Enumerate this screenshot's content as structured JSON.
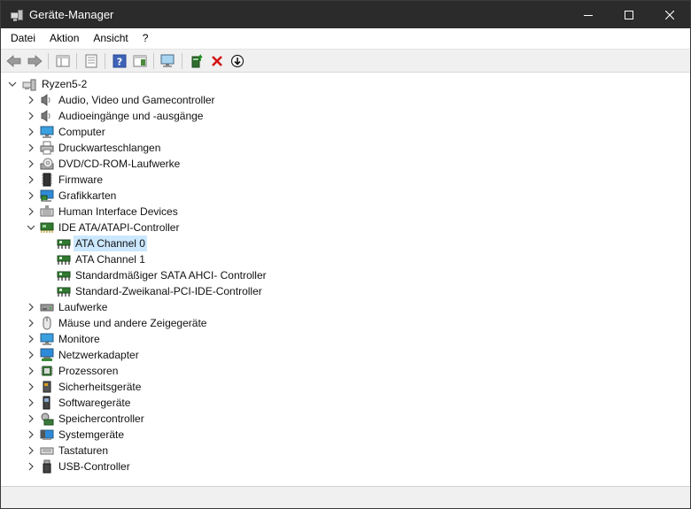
{
  "window": {
    "title": "Geräte-Manager"
  },
  "menu": [
    {
      "label": "Datei"
    },
    {
      "label": "Aktion"
    },
    {
      "label": "Ansicht"
    },
    {
      "label": "?"
    }
  ],
  "toolbar": {
    "icons": [
      "back-arrow-icon",
      "forward-arrow-icon",
      "show-hide-console-tree-icon",
      "properties-icon",
      "help-icon",
      "action-pane-icon",
      "scan-hardware-monitor-icon",
      "update-driver-icon",
      "uninstall-device-icon",
      "disable-device-icon"
    ]
  },
  "tree": {
    "root": "Ryzen5-2",
    "categories": [
      {
        "label": "Audio, Video und Gamecontroller",
        "expanded": false
      },
      {
        "label": "Audioeingänge und -ausgänge",
        "expanded": false
      },
      {
        "label": "Computer",
        "expanded": false
      },
      {
        "label": "Druckwarteschlangen",
        "expanded": false
      },
      {
        "label": "DVD/CD-ROM-Laufwerke",
        "expanded": false
      },
      {
        "label": "Firmware",
        "expanded": false
      },
      {
        "label": "Grafikkarten",
        "expanded": false
      },
      {
        "label": "Human Interface Devices",
        "expanded": false
      },
      {
        "label": "IDE ATA/ATAPI-Controller",
        "expanded": true
      },
      {
        "label": "Laufwerke",
        "expanded": false
      },
      {
        "label": "Mäuse und andere Zeigegeräte",
        "expanded": false
      },
      {
        "label": "Monitore",
        "expanded": false
      },
      {
        "label": "Netzwerkadapter",
        "expanded": false
      },
      {
        "label": "Prozessoren",
        "expanded": false
      },
      {
        "label": "Sicherheitsgeräte",
        "expanded": false
      },
      {
        "label": "Softwaregeräte",
        "expanded": false
      },
      {
        "label": "Speichercontroller",
        "expanded": false
      },
      {
        "label": "Systemgeräte",
        "expanded": false
      },
      {
        "label": "Tastaturen",
        "expanded": false
      },
      {
        "label": "USB-Controller",
        "expanded": false
      }
    ],
    "ide_children": [
      {
        "label": "ATA Channel 0",
        "selected": true
      },
      {
        "label": "ATA Channel 1",
        "selected": false
      },
      {
        "label": "Standardmäßiger SATA AHCI- Controller",
        "selected": false
      },
      {
        "label": "Standard-Zweikanal-PCI-IDE-Controller",
        "selected": false
      }
    ]
  },
  "colors": {
    "titlebar": "#2b2b2b",
    "selection": "#cce8ff",
    "toolbar": "#f0f0f0"
  }
}
